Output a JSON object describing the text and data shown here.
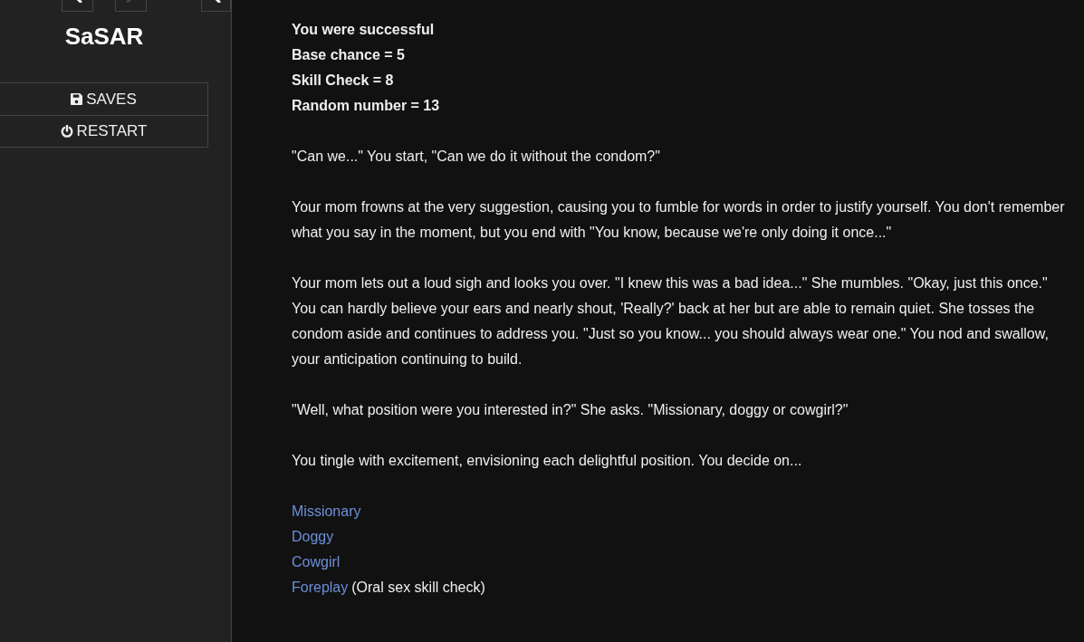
{
  "sidebar": {
    "history": [
      {
        "kind": "back",
        "disabled": false
      },
      {
        "kind": "forward",
        "disabled": true
      }
    ],
    "title": "SaSAR",
    "menu": [
      {
        "kind": "saves",
        "label": "SAVES"
      },
      {
        "kind": "restart",
        "label": "RESTART"
      }
    ]
  },
  "passage": {
    "stats": [
      "You were successful",
      "Base chance = 5",
      "Skill Check = 8",
      "Random number = 13"
    ],
    "paragraphs": [
      "\"Can we...\" You start, \"Can we do it without the condom?\"",
      "Your mom frowns at the very suggestion, causing you to fumble for words in order to justify yourself. You don't remember what you say in the moment, but you end with \"You know, because we're only doing it once...\"",
      "Your mom lets out a loud sigh and looks you over. \"I knew this was a bad idea...\" She mumbles. \"Okay, just this once.\" You can hardly believe your ears and nearly shout, 'Really?' back at her but are able to remain quiet. She tosses the condom aside and continues to address you. \"Just so you know... you should always wear one.\" You nod and swallow, your anticipation continuing to build.",
      "\"Well, what position were you interested in?\" She asks. \"Missionary, doggy or cowgirl?\"",
      "You tingle with excitement, envisioning each delightful position. You decide on..."
    ],
    "choices": [
      {
        "label": "Missionary"
      },
      {
        "label": "Doggy"
      },
      {
        "label": "Cowgirl"
      },
      {
        "label": "Foreplay",
        "note": "(Oral sex skill check)"
      }
    ]
  }
}
